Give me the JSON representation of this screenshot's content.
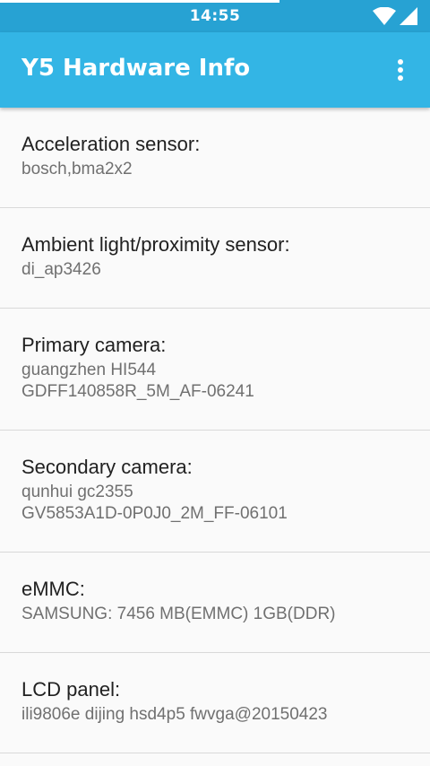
{
  "status_bar": {
    "time": "14:55",
    "icons": [
      "wifi-icon",
      "cellular-signal-icon"
    ],
    "background": "#27a2d3"
  },
  "app_bar": {
    "title": "Y5 Hardware Info",
    "menu_icon": "overflow-menu-icon",
    "background": "#33b5e5"
  },
  "items": [
    {
      "label": "Acceleration sensor:",
      "values": [
        "bosch,bma2x2"
      ]
    },
    {
      "label": "Ambient light/proximity sensor:",
      "values": [
        "di_ap3426"
      ]
    },
    {
      "label": "Primary camera:",
      "values": [
        "guangzhen HI544",
        "GDFF140858R_5M_AF-06241"
      ]
    },
    {
      "label": "Secondary camera:",
      "values": [
        "qunhui gc2355",
        "GV5853A1D-0P0J0_2M_FF-06101"
      ]
    },
    {
      "label": "eMMC:",
      "values": [
        "SAMSUNG: 7456 MB(EMMC) 1GB(DDR)"
      ]
    },
    {
      "label": "LCD panel:",
      "values": [
        "ili9806e dijing hsd4p5 fwvga@20150423"
      ]
    }
  ]
}
